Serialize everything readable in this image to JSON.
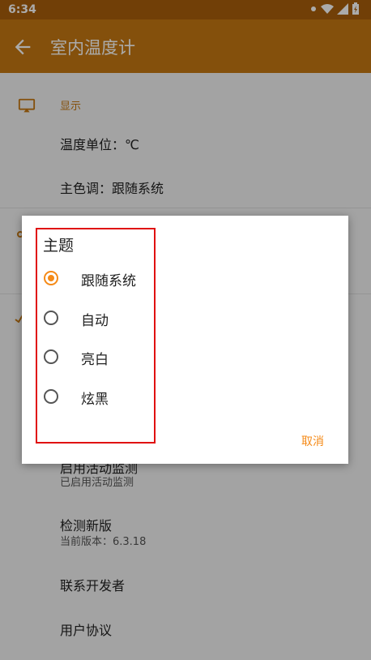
{
  "status_bar": {
    "time": "6:34"
  },
  "app_bar": {
    "title": "室内温度计"
  },
  "settings": {
    "display_section": {
      "label": "显示"
    },
    "temperature_unit": "温度单位：℃",
    "main_tone": "主色调：跟随系统",
    "activity_monitor": {
      "title": "启用活动监测",
      "subtitle": "已启用活动监测"
    },
    "check_update": {
      "title": "检测新版",
      "subtitle": "当前版本：6.3.18"
    },
    "contact_dev": "联系开发者",
    "user_agreement": "用户协议"
  },
  "dialog": {
    "title": "主题",
    "options": [
      {
        "label": "跟随系统",
        "selected": true
      },
      {
        "label": "自动",
        "selected": false
      },
      {
        "label": "亮白",
        "selected": false
      },
      {
        "label": "炫黑",
        "selected": false
      }
    ],
    "cancel_label": "取消"
  },
  "colors": {
    "status_bar": "#a95f0b",
    "app_bar": "#c57812",
    "accent": "#f58a17",
    "highlight_box": "#e01010"
  }
}
